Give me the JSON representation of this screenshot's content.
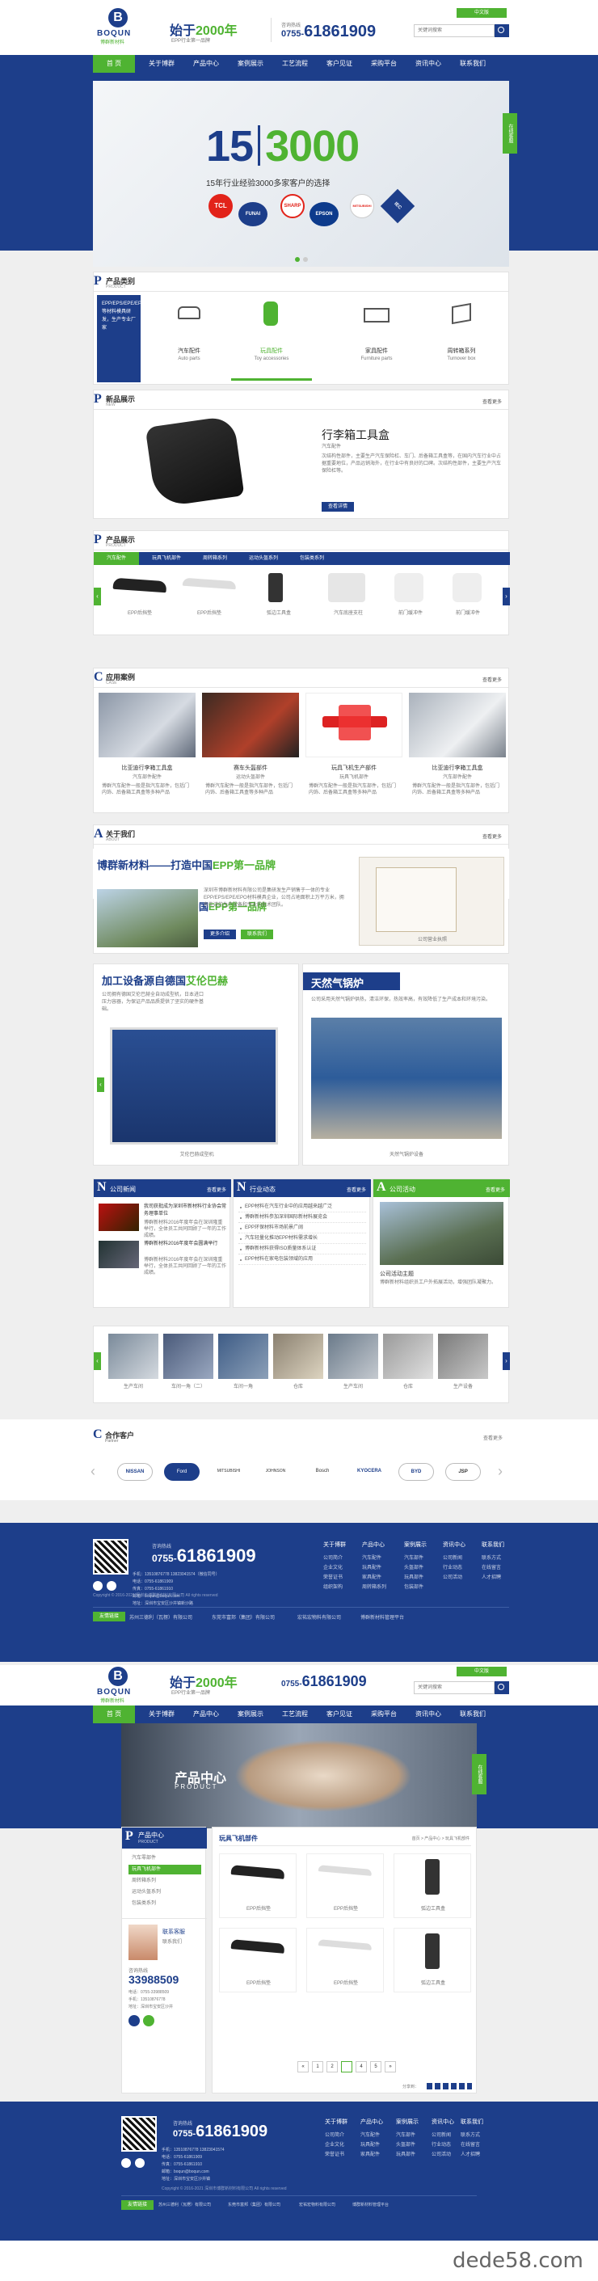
{
  "page1": {
    "header": {
      "brand": "BOQUN",
      "brand_cn": "博群新材料",
      "slogan_pre": "始于",
      "slogan_year": "2000年",
      "slogan_sub": "EPP行业第一品牌",
      "hotline_label": "咨询热线",
      "phone_prefix": "0755-",
      "phone": "61861909",
      "search_placeholder": "关键词搜索",
      "corner_link": "中文版"
    },
    "nav": [
      "首 页",
      "关于博群",
      "产品中心",
      "案例展示",
      "工艺流程",
      "客户见证",
      "采购平台",
      "资讯中心",
      "联系我们"
    ],
    "banner": {
      "big_left": "15",
      "big_right": "3000",
      "caption": "15年行业经验3000多家客户的选择",
      "logos": [
        "TCL",
        "FUNAI",
        "SHARP",
        "EPSON",
        "MITSUBISHI",
        "IEC"
      ],
      "side_tab": "在线客服"
    },
    "products_cat": {
      "title": "产品类别",
      "sub": "PRODUCT",
      "intro": "EPP/EPS/EPE/EPO等材料模具研发，生产专业厂家",
      "items": [
        {
          "name": "汽车配件",
          "sub": "Auto parts",
          "icon": "car-icon"
        },
        {
          "name": "玩具配件",
          "sub": "Toy accessories",
          "icon": "toy-icon"
        },
        {
          "name": "家具配件",
          "sub": "Furniture parts",
          "icon": "kitchen-icon"
        },
        {
          "name": "周转箱系列",
          "sub": "Turnover box",
          "icon": "box-icon"
        }
      ]
    },
    "new_product": {
      "title": "新品展示",
      "sub": "NEW",
      "more": "查看更多",
      "name": "行李箱工具盒",
      "name_sub": "汽车配件",
      "desc": "次结构性部件，主要生产汽车保险杠、车门、后备箱工具盒等，在国内汽车行业中占据重要地位，产品远销海外，在行业中有良好的口碑。次结构性部件，主要生产汽车保险杠等。",
      "btn": "查看详情"
    },
    "products": {
      "title": "产品展示",
      "sub": "PRODUCT",
      "more": "查看更多",
      "tabs": [
        "汽车配件",
        "玩具飞机部件",
        "周转箱系列",
        "运动头盔系列",
        "包装类系列"
      ],
      "items": [
        "EPP后挡垫",
        "EPP后挡垫",
        "弧边工具盒",
        "汽车底座支柱",
        "前门缓冲件",
        "前门缓冲件"
      ]
    },
    "cases": {
      "title": "应用案例",
      "sub": "CASE",
      "more": "查看更多",
      "items": [
        {
          "name": "比亚迪行李箱工具盒",
          "sub": "汽车部件配件",
          "desc": "博群汽车配件一般是指汽车部件，包括门内饰、后备箱工具盒等多种产品"
        },
        {
          "name": "赛车头盔部件",
          "sub": "运动头盔部件",
          "desc": "博群汽车配件一般是指汽车部件，包括门内饰、后备箱工具盒等多种产品"
        },
        {
          "name": "玩具飞机生产部件",
          "sub": "玩具飞机部件",
          "desc": "博群汽车配件一般是指汽车部件，包括门内饰、后备箱工具盒等多种产品"
        },
        {
          "name": "比亚迪行李箱工具盒",
          "sub": "汽车部件配件",
          "desc": "博群汽车配件一般是指汽车部件，包括门内饰、后备箱工具盒等多种产品"
        }
      ]
    },
    "about": {
      "title": "关于我们",
      "sub": "ABOUT",
      "more": "查看更多",
      "headline_pre": "博群新材料——打造中国",
      "headline_em": "EPP第一品牌",
      "desc": "深圳市博群新材料有限公司是集研发生产销售于一体的专业EPP/EPS/EPE/EPO材料模具企业，公司占地面积上万平方米，拥有先进的生产设备和专业的技术团队。",
      "btn1": "更多介绍",
      "btn2": "联系我们",
      "cert_caption": "公司营业执照"
    },
    "factory": {
      "left_title_pre": "加工设备源自德国",
      "left_title_em": "艾伦巴赫",
      "left_desc": "公司拥有德国艾伦巴赫全自动成型机，日本进口压力容器，为保证产品品质提供了坚实的硬件基础。",
      "left_caption": "艾伦巴赫成型机",
      "right_title": "天然气锅炉",
      "right_desc": "公司采用天然气锅炉供热，清洁环保，热效率高，有效降低了生产成本和环境污染。",
      "right_caption": "天然气锅炉设备"
    },
    "news": {
      "col1": {
        "letter": "N",
        "title": "公司新闻",
        "more": "查看更多",
        "items": [
          "我司获批成为深圳市新材料行业协会常务理事单位",
          "博群新材料2016年度年会圆满举行"
        ],
        "desc": "博群新材料2016年度年会在深圳隆重举行，全体员工共同回顾了一年的工作成绩。"
      },
      "col2": {
        "letter": "N",
        "title": "行业动态",
        "more": "查看更多",
        "items": [
          "EPP材料在汽车行业中的应用越来越广泛",
          "博群新材料参加深圳国际新材料展览会",
          "EPP环保材料市场前景广阔",
          "汽车轻量化推动EPP材料需求增长",
          "博群新材料获得ISO质量体系认证",
          "EPP材料在家电包装领域的应用"
        ]
      },
      "col3": {
        "letter": "A",
        "title": "公司活动",
        "more": "查看更多",
        "caption": "公司活动主题",
        "desc": "博群新材料组织员工户外拓展活动，增强团队凝聚力。"
      }
    },
    "gallery": {
      "captions": [
        "生产车间",
        "车间一角（二）",
        "车间一角",
        "仓库",
        "生产车间",
        "仓库",
        "生产设备"
      ]
    },
    "partners": {
      "title": "合作客户",
      "sub": "Partner",
      "more": "查看更多",
      "items": [
        "NISSAN",
        "Ford",
        "MITSUBISHI",
        "JOHNSON",
        "Bosch",
        "KYOCERA",
        "BYD",
        "JSP"
      ]
    },
    "footer": {
      "hotline_label": "咨询热线",
      "phone_prefix": "0755-",
      "phone": "61861909",
      "contacts": [
        "手机：13510876778  13823041574（微信同号）",
        "电话：0755-61861909",
        "传真：0755-61861910",
        "邮箱：boqun@boqun.com",
        "地址：深圳市宝安区沙井镇新沙路"
      ],
      "cols": [
        {
          "h": "关于博群",
          "items": [
            "公司简介",
            "企业文化",
            "荣誉证书",
            "组织架构"
          ]
        },
        {
          "h": "产品中心",
          "items": [
            "汽车配件",
            "玩具配件",
            "家具配件",
            "周转箱系列"
          ]
        },
        {
          "h": "案例展示",
          "items": [
            "汽车部件",
            "头盔部件",
            "玩具部件",
            "包装部件"
          ]
        },
        {
          "h": "资讯中心",
          "items": [
            "公司新闻",
            "行业动态",
            "公司活动"
          ]
        },
        {
          "h": "联系我们",
          "items": [
            "联系方式",
            "在线留言",
            "人才招聘"
          ]
        }
      ],
      "links_label": "友情链接",
      "links": [
        "苏州三德利（瓦楞）有限公司",
        "东莞市富邦（集团）有限公司",
        "宏祐宏物料有限公司",
        "博群新材料管理平台"
      ],
      "copyright": "Copyright © 2016-2021 深圳市博群新材料有限公司 All rights reserved"
    }
  },
  "page2": {
    "header": {
      "brand": "BOQUN",
      "brand_cn": "博群新材料",
      "slogan_pre": "始于",
      "slogan_year": "2000年",
      "slogan_sub": "EPP行业第一品牌",
      "phone_prefix": "0755-",
      "phone": "61861909",
      "search_placeholder": "关键词搜索",
      "corner_link": "中文版"
    },
    "nav": [
      "首 页",
      "关于博群",
      "产品中心",
      "案例展示",
      "工艺流程",
      "客户见证",
      "采购平台",
      "资讯中心",
      "联系我们"
    ],
    "banner": {
      "title": "产品中心",
      "sub": "PRODUCT"
    },
    "sidebar": {
      "title": "产品中心",
      "sub": "PRODUCT",
      "items": [
        "汽车零部件",
        "玩具飞机部件",
        "周转箱系列",
        "运动头盔系列",
        "包装类系列"
      ],
      "contact_title": "联系我们",
      "contact_name": "联系客服",
      "contact_phone_label": "咨询热线",
      "contact_phone": "33988509",
      "contact_lines": [
        "电话：0755-33988509",
        "手机：13510876778",
        "地址：深圳市宝安区沙井"
      ]
    },
    "list": {
      "title": "玩具飞机部件",
      "crumb": "首页 > 产品中心 > 玩具飞机部件",
      "items": [
        "EPP后挡垫",
        "EPP后挡垫",
        "弧边工具盒",
        "EPP后挡垫",
        "EPP后挡垫",
        "弧边工具盒"
      ],
      "pages": [
        "«",
        "1",
        "2",
        "3",
        "4",
        "5",
        "»"
      ],
      "active_page": "3",
      "share_label": "分享到："
    },
    "footer": {
      "hotline_label": "咨询热线",
      "phone_prefix": "0755-",
      "phone": "61861909",
      "contacts": [
        "手机：13510876778  13823041574",
        "电话：0755-61861909",
        "传真：0755-61861910",
        "邮箱：boqun@boqun.com",
        "地址：深圳市宝安区沙井镇"
      ],
      "cols": [
        {
          "h": "关于博群",
          "items": [
            "公司简介",
            "企业文化",
            "荣誉证书"
          ]
        },
        {
          "h": "产品中心",
          "items": [
            "汽车配件",
            "玩具配件",
            "家具配件"
          ]
        },
        {
          "h": "案例展示",
          "items": [
            "汽车部件",
            "头盔部件",
            "玩具部件"
          ]
        },
        {
          "h": "资讯中心",
          "items": [
            "公司新闻",
            "行业动态",
            "公司活动"
          ]
        },
        {
          "h": "联系我们",
          "items": [
            "联系方式",
            "在线留言",
            "人才招聘"
          ]
        }
      ],
      "links_label": "友情链接",
      "links": [
        "苏州三德利（瓦楞）有限公司",
        "东莞市富邦（集团）有限公司",
        "宏祐宏物料有限公司",
        "博群新材料管理平台"
      ],
      "copyright": "Copyright © 2016-2021 深圳市博群新材料有限公司 All rights reserved"
    }
  },
  "watermark": "dede58.com",
  "colors": {
    "brand_blue": "#1d3e8a",
    "brand_green": "#4fb332"
  }
}
